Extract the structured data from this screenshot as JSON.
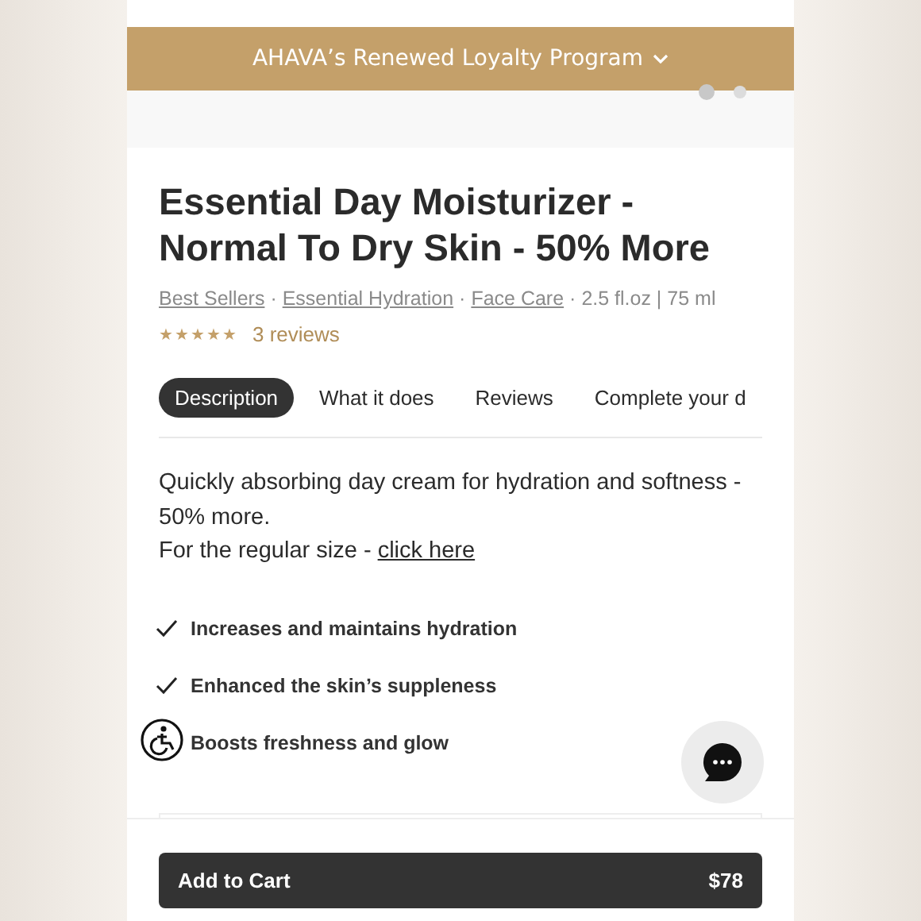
{
  "banner": {
    "text": "AHAVA’s Renewed Loyalty Program",
    "expanded": false
  },
  "carousel_dots": [
    {
      "selected": true
    },
    {
      "selected": false
    }
  ],
  "product": {
    "title": "Essential Day Moisturizer - Normal To Dry Skin - 50% More",
    "breadcrumbs": [
      "Best Sellers",
      "Essential Hydration",
      "Face Care"
    ],
    "separator": "·",
    "size": "2.5 fl.oz | 75 ml",
    "stars": 5,
    "reviews": "3 reviews"
  },
  "tabs": [
    {
      "label": "Description",
      "selected": true
    },
    {
      "label": "What it does",
      "selected": false
    },
    {
      "label": "Reviews",
      "selected": false
    },
    {
      "label": "Complete your d",
      "selected": false
    }
  ],
  "description": {
    "text": "Quickly absorbing day cream for hydration and softness - 50% more.",
    "regular_size_prefix": "For the regular size - ",
    "link": "click here"
  },
  "benefits": [
    {
      "text": "Increases and maintains hydration",
      "checked": true
    },
    {
      "text": "Enhanced the skin’s suppleness",
      "checked": true
    },
    {
      "text": "Boosts freshness and glow"
    }
  ],
  "cart_button": {
    "label": "Add to Cart",
    "price": "$78"
  }
}
